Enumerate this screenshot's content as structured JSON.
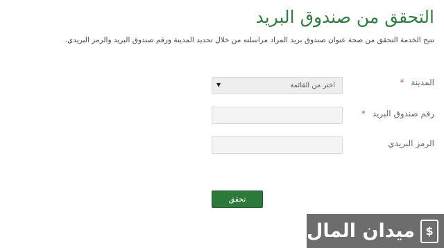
{
  "header": {
    "title": "التحقق من صندوق البريد",
    "description": "تتيح الخدمة التحقق من صحة عنوان صندوق بريد المراد مراسلته من خلال تحديد المدينة ورقم صندوق البريد والرمز البريدي."
  },
  "form": {
    "city": {
      "label": "المدينة",
      "required_mark": "*",
      "selected": "اختر من القائمة",
      "icon": "triangle-down-icon"
    },
    "po_box": {
      "label": "رقم صندوق البريد",
      "required_mark": "*",
      "value": ""
    },
    "postal_code": {
      "label": "الرمز البريدي",
      "value": ""
    },
    "submit_label": "تحقق"
  },
  "brand": {
    "text": "ميدان المال",
    "icon_glyph": "$",
    "icon": "money-icon"
  },
  "colors": {
    "title": "#2f7d3c",
    "button": "#2c7a39",
    "required": "#d9534f",
    "brand_bg": "#6d6d6d"
  }
}
